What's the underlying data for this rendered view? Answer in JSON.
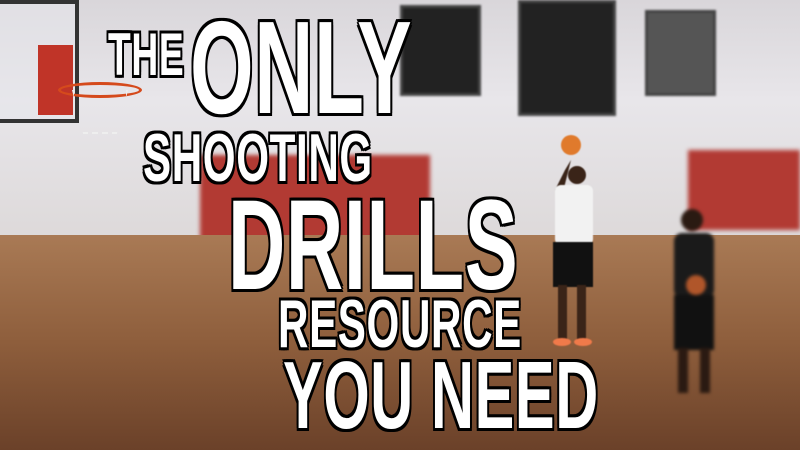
{
  "headline": {
    "line1a": "THE",
    "line1b": "ONLY",
    "line2": "SHOOTING",
    "line3": "DRILLS",
    "line4": "RESOURCE",
    "line5": "YOU NEED"
  },
  "colors": {
    "text": "#ffffff",
    "outline": "#000000",
    "pad": "#b23a33",
    "floor": "#8e5e3c"
  }
}
